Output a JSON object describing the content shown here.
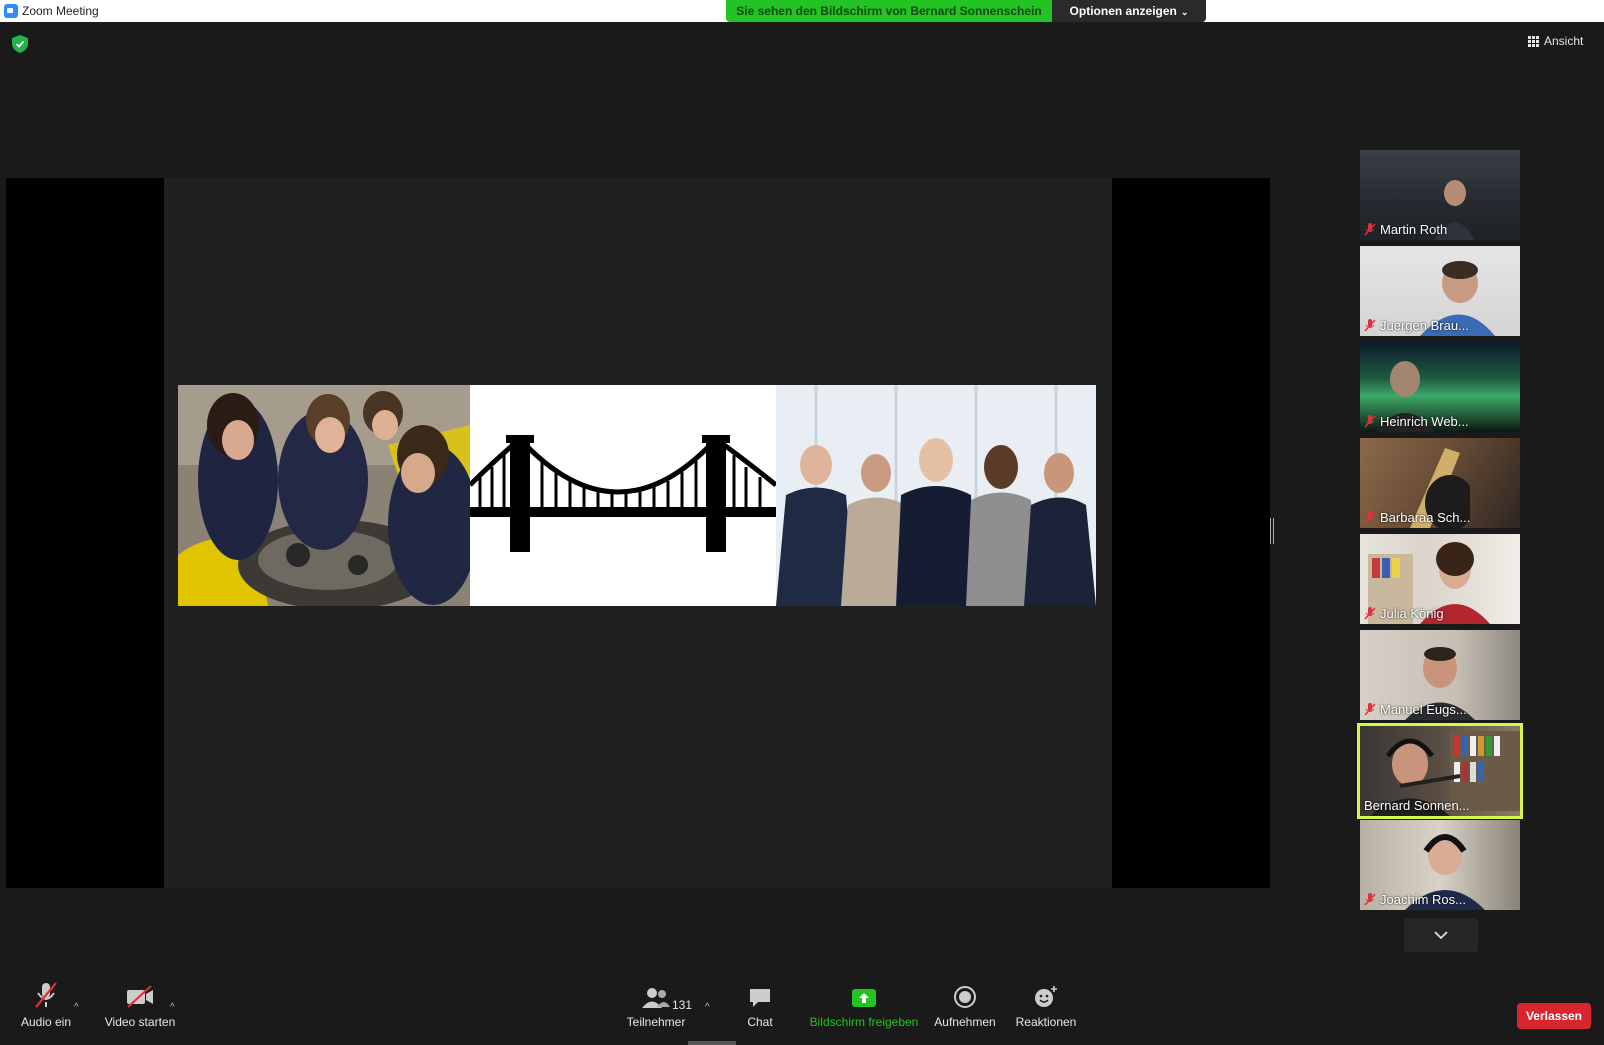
{
  "window": {
    "title": "Zoom Meeting"
  },
  "share_banner": {
    "text": "Sie sehen den Bildschirm von Bernard Sonnenschein",
    "options_label": "Optionen anzeigen"
  },
  "view_button": {
    "label": "Ansicht"
  },
  "participants": [
    {
      "name": "Martin Roth",
      "muted": true,
      "active": false
    },
    {
      "name": "Juergen Brau...",
      "muted": true,
      "active": false
    },
    {
      "name": "Heinrich Web...",
      "muted": true,
      "active": false
    },
    {
      "name": "Barbaraa Sch...",
      "muted": true,
      "active": false
    },
    {
      "name": "Julia König",
      "muted": true,
      "active": false
    },
    {
      "name": "Manuel Eugs...",
      "muted": true,
      "active": false
    },
    {
      "name": "Bernard Sonnen...",
      "muted": false,
      "active": true
    },
    {
      "name": "Joachim Ros...",
      "muted": true,
      "active": false
    }
  ],
  "toolbar": {
    "audio_label": "Audio ein",
    "video_label": "Video starten",
    "participants_label": "Teilnehmer",
    "participants_count": "131",
    "chat_label": "Chat",
    "share_label": "Bildschirm freigeben",
    "record_label": "Aufnehmen",
    "reactions_label": "Reaktionen",
    "leave_label": "Verlassen"
  },
  "colors": {
    "share_banner_bg": "#22c322",
    "share_button_green": "#22c322",
    "leave_red": "#d9262e",
    "active_speaker_outline": "#d4f84a",
    "mute_red": "#e0303a"
  },
  "icons": [
    "zoom-app-icon",
    "shield-icon",
    "grid-icon",
    "mic-muted-icon",
    "video-off-icon",
    "participants-icon",
    "chat-icon",
    "share-screen-icon",
    "record-icon",
    "reactions-icon",
    "chevron-down-icon"
  ]
}
